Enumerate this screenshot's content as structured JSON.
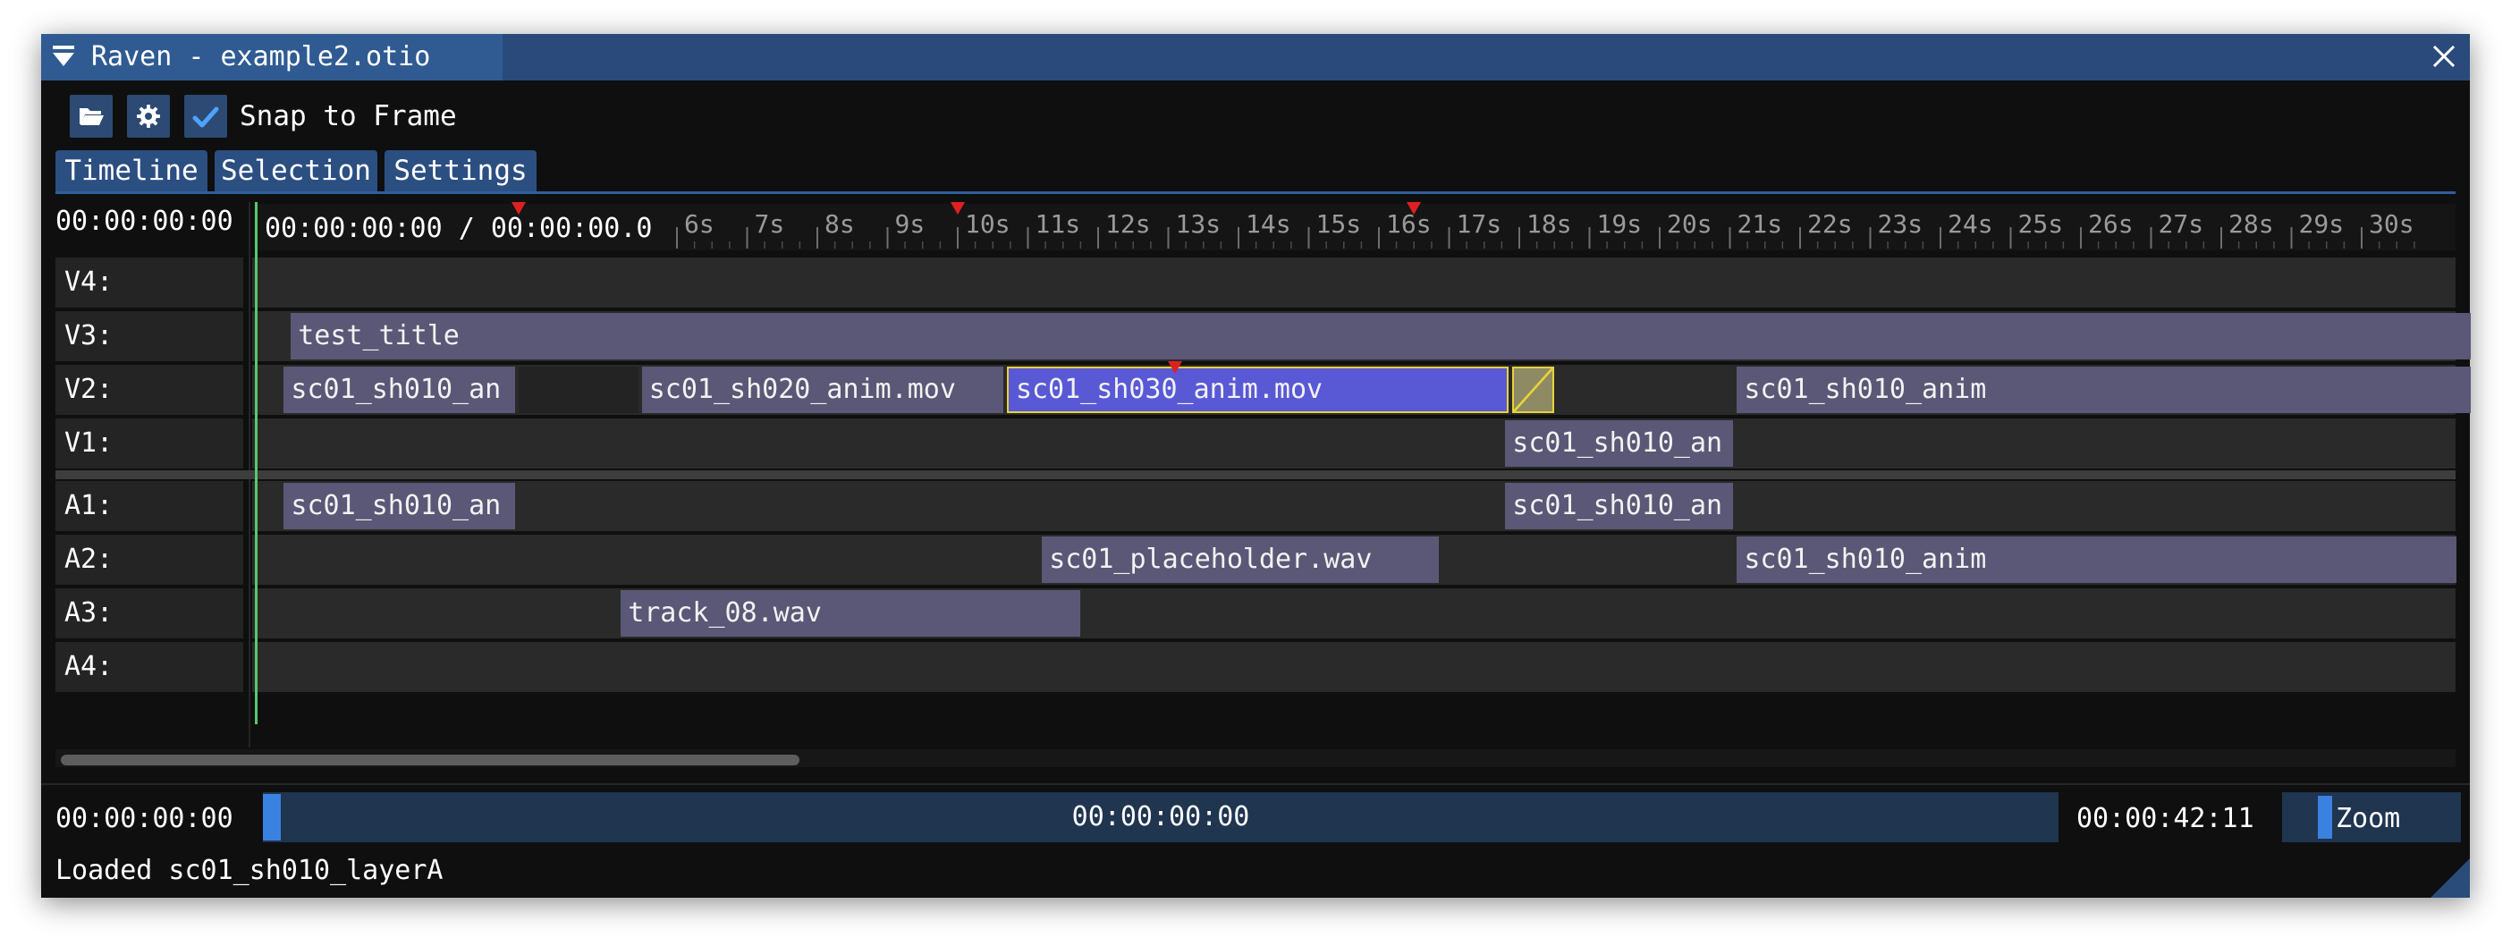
{
  "window": {
    "title": "Raven - example2.otio",
    "icons": {
      "menu": "collapse-triangle-icon",
      "close": "close-icon"
    }
  },
  "toolbar": {
    "open_icon": "folder-open-icon",
    "settings_icon": "gear-icon",
    "snap_icon": "checkmark-icon",
    "snap_checked": true,
    "snap_label": "Snap to Frame"
  },
  "tabs": [
    {
      "label": "Timeline",
      "active": true
    },
    {
      "label": "Selection",
      "active": false
    },
    {
      "label": "Settings",
      "active": false
    }
  ],
  "ruler": {
    "current_time": "00:00:00:00",
    "overlay_text": "00:00:00:00 / 00:00:00.0",
    "ticks": [
      "6s",
      "7s",
      "8s",
      "9s",
      "10s",
      "11s",
      "12s",
      "13s",
      "14s",
      "15s",
      "16s",
      "17s",
      "18s",
      "19s",
      "20s",
      "21s",
      "22s",
      "23s",
      "24s",
      "25s",
      "26s",
      "27s",
      "28s",
      "29s",
      "30s"
    ]
  },
  "tracks": [
    {
      "name": "V4:",
      "clips": []
    },
    {
      "name": "V3:",
      "clips": [
        {
          "label": "test_title",
          "start_s": 0.5,
          "end_s": 31.6
        }
      ]
    },
    {
      "name": "V2:",
      "clips": [
        {
          "label": "sc01_sh010_an",
          "start_s": 0.4,
          "end_s": 3.75
        },
        {
          "label": "",
          "start_s": 3.75,
          "end_s": 5.5
        },
        {
          "label": "sc01_sh020_anim.mov",
          "start_s": 5.5,
          "end_s": 10.7
        },
        {
          "label": "sc01_sh030_anim.mov",
          "start_s": 10.7,
          "end_s": 17.9,
          "selected": true
        },
        {
          "label": "sc01_sh010_anim",
          "start_s": 21.1,
          "end_s": 31.6
        }
      ],
      "transition": {
        "start_s": 17.9,
        "end_s": 18.5
      }
    },
    {
      "name": "V1:",
      "clips": [
        {
          "label": "sc01_sh010_an",
          "start_s": 17.8,
          "end_s": 21.1
        }
      ]
    },
    {
      "name": "A1:",
      "clips": [
        {
          "label": "sc01_sh010_an",
          "start_s": 0.4,
          "end_s": 3.75
        },
        {
          "label": "sc01_sh010_an",
          "start_s": 17.8,
          "end_s": 21.1
        }
      ]
    },
    {
      "name": "A2:",
      "clips": [
        {
          "label": "sc01_placeholder.wav",
          "start_s": 11.2,
          "end_s": 16.9
        },
        {
          "label": "sc01_sh010_anim",
          "start_s": 21.1,
          "end_s": 31.4
        }
      ]
    },
    {
      "name": "A3:",
      "clips": [
        {
          "label": "track_08.wav",
          "start_s": 5.2,
          "end_s": 11.8
        }
      ]
    },
    {
      "name": "A4:",
      "clips": []
    }
  ],
  "markers_s": [
    3.75,
    10.0,
    16.5,
    13.1
  ],
  "footer": {
    "start_timecode": "00:00:00:00",
    "current_timecode": "00:00:00:00",
    "end_timecode": "00:00:42:11",
    "zoom_label": "Zoom"
  },
  "status": "Loaded sc01_sh010_layerA",
  "colors": {
    "clip": "#5a5876",
    "selected_clip": "#5959d6",
    "selection_outline": "#e8d23a",
    "marker": "#e02020",
    "playhead": "#58c96a",
    "accent": "#2c4f82"
  }
}
